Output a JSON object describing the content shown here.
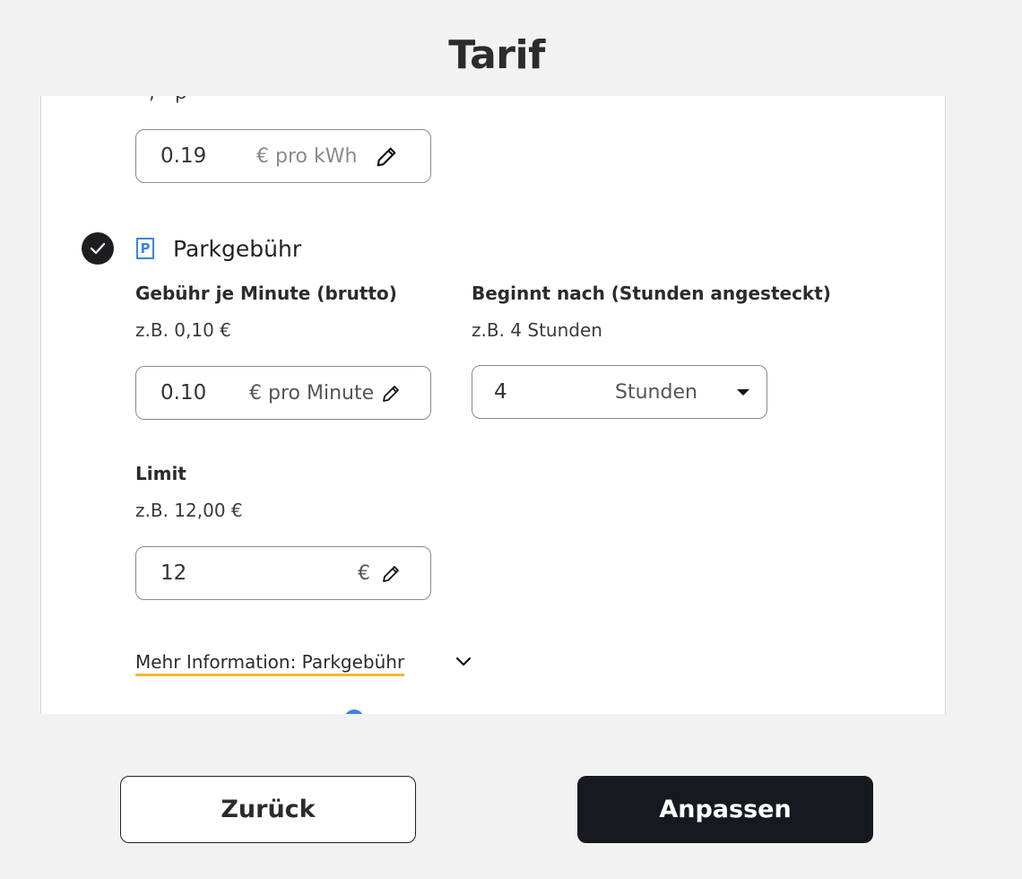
{
  "page": {
    "title": "Tarif"
  },
  "energy": {
    "cut_text": "- , - p",
    "value": "0.19",
    "unit": "€ pro kWh"
  },
  "parking": {
    "title": "Parkgebühr",
    "p_icon_letter": "P",
    "checked": true,
    "fee": {
      "label": "Gebühr je Minute (brutto)",
      "hint": "z.B. 0,10 €",
      "value": "0.10",
      "unit": "€ pro Minute"
    },
    "start": {
      "label": "Beginnt nach (Stunden angesteckt)",
      "hint": "z.B. 4 Stunden",
      "value": "4",
      "unit": "Stunden"
    },
    "limit": {
      "label": "Limit",
      "hint": "z.B. 12,00 €",
      "value": "12",
      "unit": "€"
    },
    "more_info": "Mehr Information: Parkgebühr"
  },
  "buttons": {
    "back": "Zurück",
    "apply": "Anpassen"
  },
  "colors": {
    "accent_underline": "#f3b82d",
    "primary_button": "#161a20",
    "icon_blue": "#3a84dc"
  }
}
